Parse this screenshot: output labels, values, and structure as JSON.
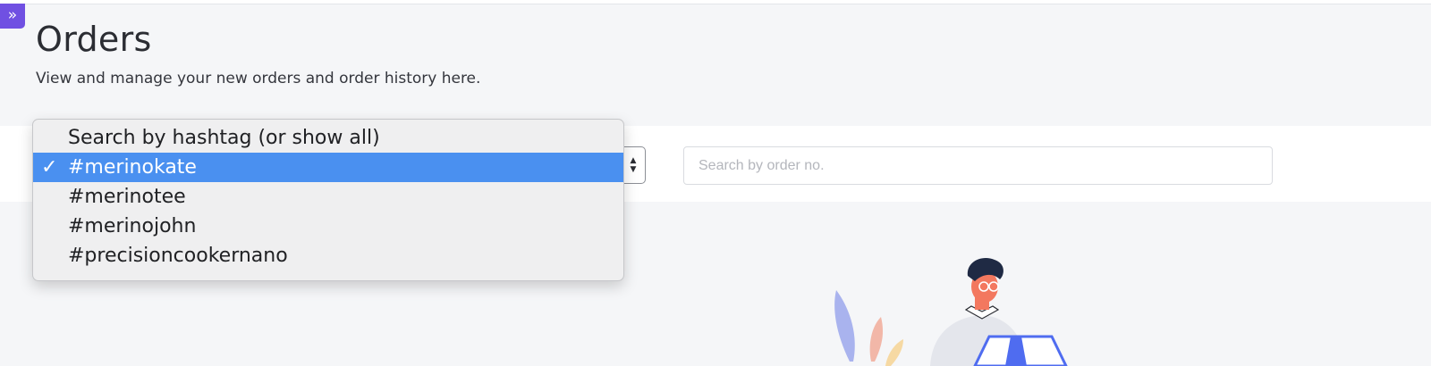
{
  "header": {
    "title": "Orders",
    "subtitle": "View and manage your new orders and order history here."
  },
  "sidebar_toggle": {
    "icon": "double-chevron-right-icon",
    "glyph": "»"
  },
  "filters": {
    "hashtag_select": {
      "selected": "#merinokate",
      "options": [
        "Search by hashtag (or show all)",
        "#merinokate",
        "#merinotee",
        "#merinojohn",
        "#precisioncookernano"
      ],
      "selected_index": 1,
      "arrows_glyph": "▲▼"
    },
    "order_search": {
      "placeholder": "Search by order no.",
      "value": ""
    }
  },
  "colors": {
    "accent": "#7050e2",
    "selection": "#4a90f0",
    "background": "#f5f6f8"
  },
  "illustration": {
    "icon": "person-at-laptop-illustration"
  }
}
